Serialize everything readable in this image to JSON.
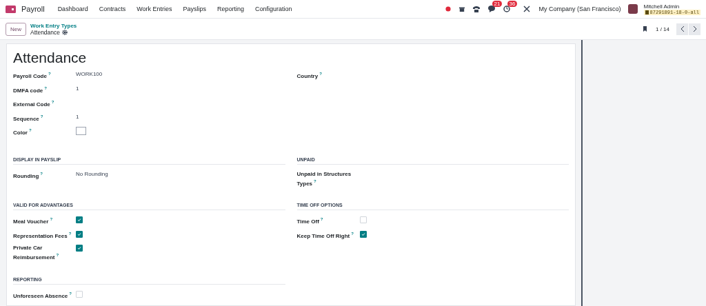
{
  "navbar": {
    "app": "Payroll",
    "menu": [
      "Dashboard",
      "Contracts",
      "Work Entries",
      "Payslips",
      "Reporting",
      "Configuration"
    ],
    "badges": [
      {
        "kind": "chat",
        "count": "21"
      },
      {
        "kind": "activity",
        "count": "36"
      }
    ],
    "company": "My Company (San Francisco)",
    "user": "Mitchell Admin",
    "database": "87291891-18-0-all"
  },
  "control_panel": {
    "new_button": "New",
    "breadcrumb": "Work Entry Types",
    "record": "Attendance",
    "pager": "1 / 14"
  },
  "form": {
    "title": "Attendance",
    "rows": [
      {
        "columns": [
          {
            "fields": [
              {
                "kind": "text",
                "label": "Payroll Code",
                "help": "?",
                "value": "WORK100"
              },
              {
                "kind": "text",
                "label": "DMFA code",
                "help": "?",
                "value": "1"
              },
              {
                "kind": "text",
                "label": "External Code",
                "help": "?"
              },
              {
                "kind": "text",
                "label": "Sequence",
                "help": "?",
                "value": "1"
              },
              {
                "kind": "color",
                "label": "Color",
                "help": "?",
                "color": "#ffffff"
              }
            ]
          },
          {
            "fields": [
              {
                "kind": "text",
                "label": "Country",
                "help": "?"
              }
            ]
          }
        ]
      },
      {
        "columns": [
          {
            "title": "DISPLAY IN PAYSLIP",
            "fields": [
              {
                "kind": "text",
                "label": "Rounding",
                "help": "?",
                "value": "No Rounding"
              }
            ]
          },
          {
            "title": "UNPAID",
            "fields": [
              {
                "kind": "text",
                "label": "Unpaid in Structures Types",
                "help": "?"
              }
            ]
          }
        ]
      },
      {
        "columns": [
          {
            "title": "VALID FOR ADVANTAGES",
            "fields": [
              {
                "kind": "checkbox",
                "label": "Meal Voucher",
                "help": "?",
                "checked": true
              },
              {
                "kind": "checkbox",
                "label": "Representation Fees",
                "help": "?",
                "checked": true
              },
              {
                "kind": "checkbox",
                "label": "Private Car Reimbursement",
                "help": "?",
                "checked": true
              }
            ]
          },
          {
            "title": "TIME OFF OPTIONS",
            "fields": [
              {
                "kind": "checkbox",
                "label": "Time Off",
                "help": "?",
                "checked": false
              },
              {
                "kind": "checkbox",
                "label": "Keep Time Off Right",
                "help": "?",
                "checked": true
              }
            ]
          }
        ]
      },
      {
        "columns": [
          {
            "title": "REPORTING",
            "fields": [
              {
                "kind": "checkbox",
                "label": "Unforeseen Absence",
                "help": "?",
                "checked": false
              }
            ]
          }
        ]
      }
    ]
  }
}
